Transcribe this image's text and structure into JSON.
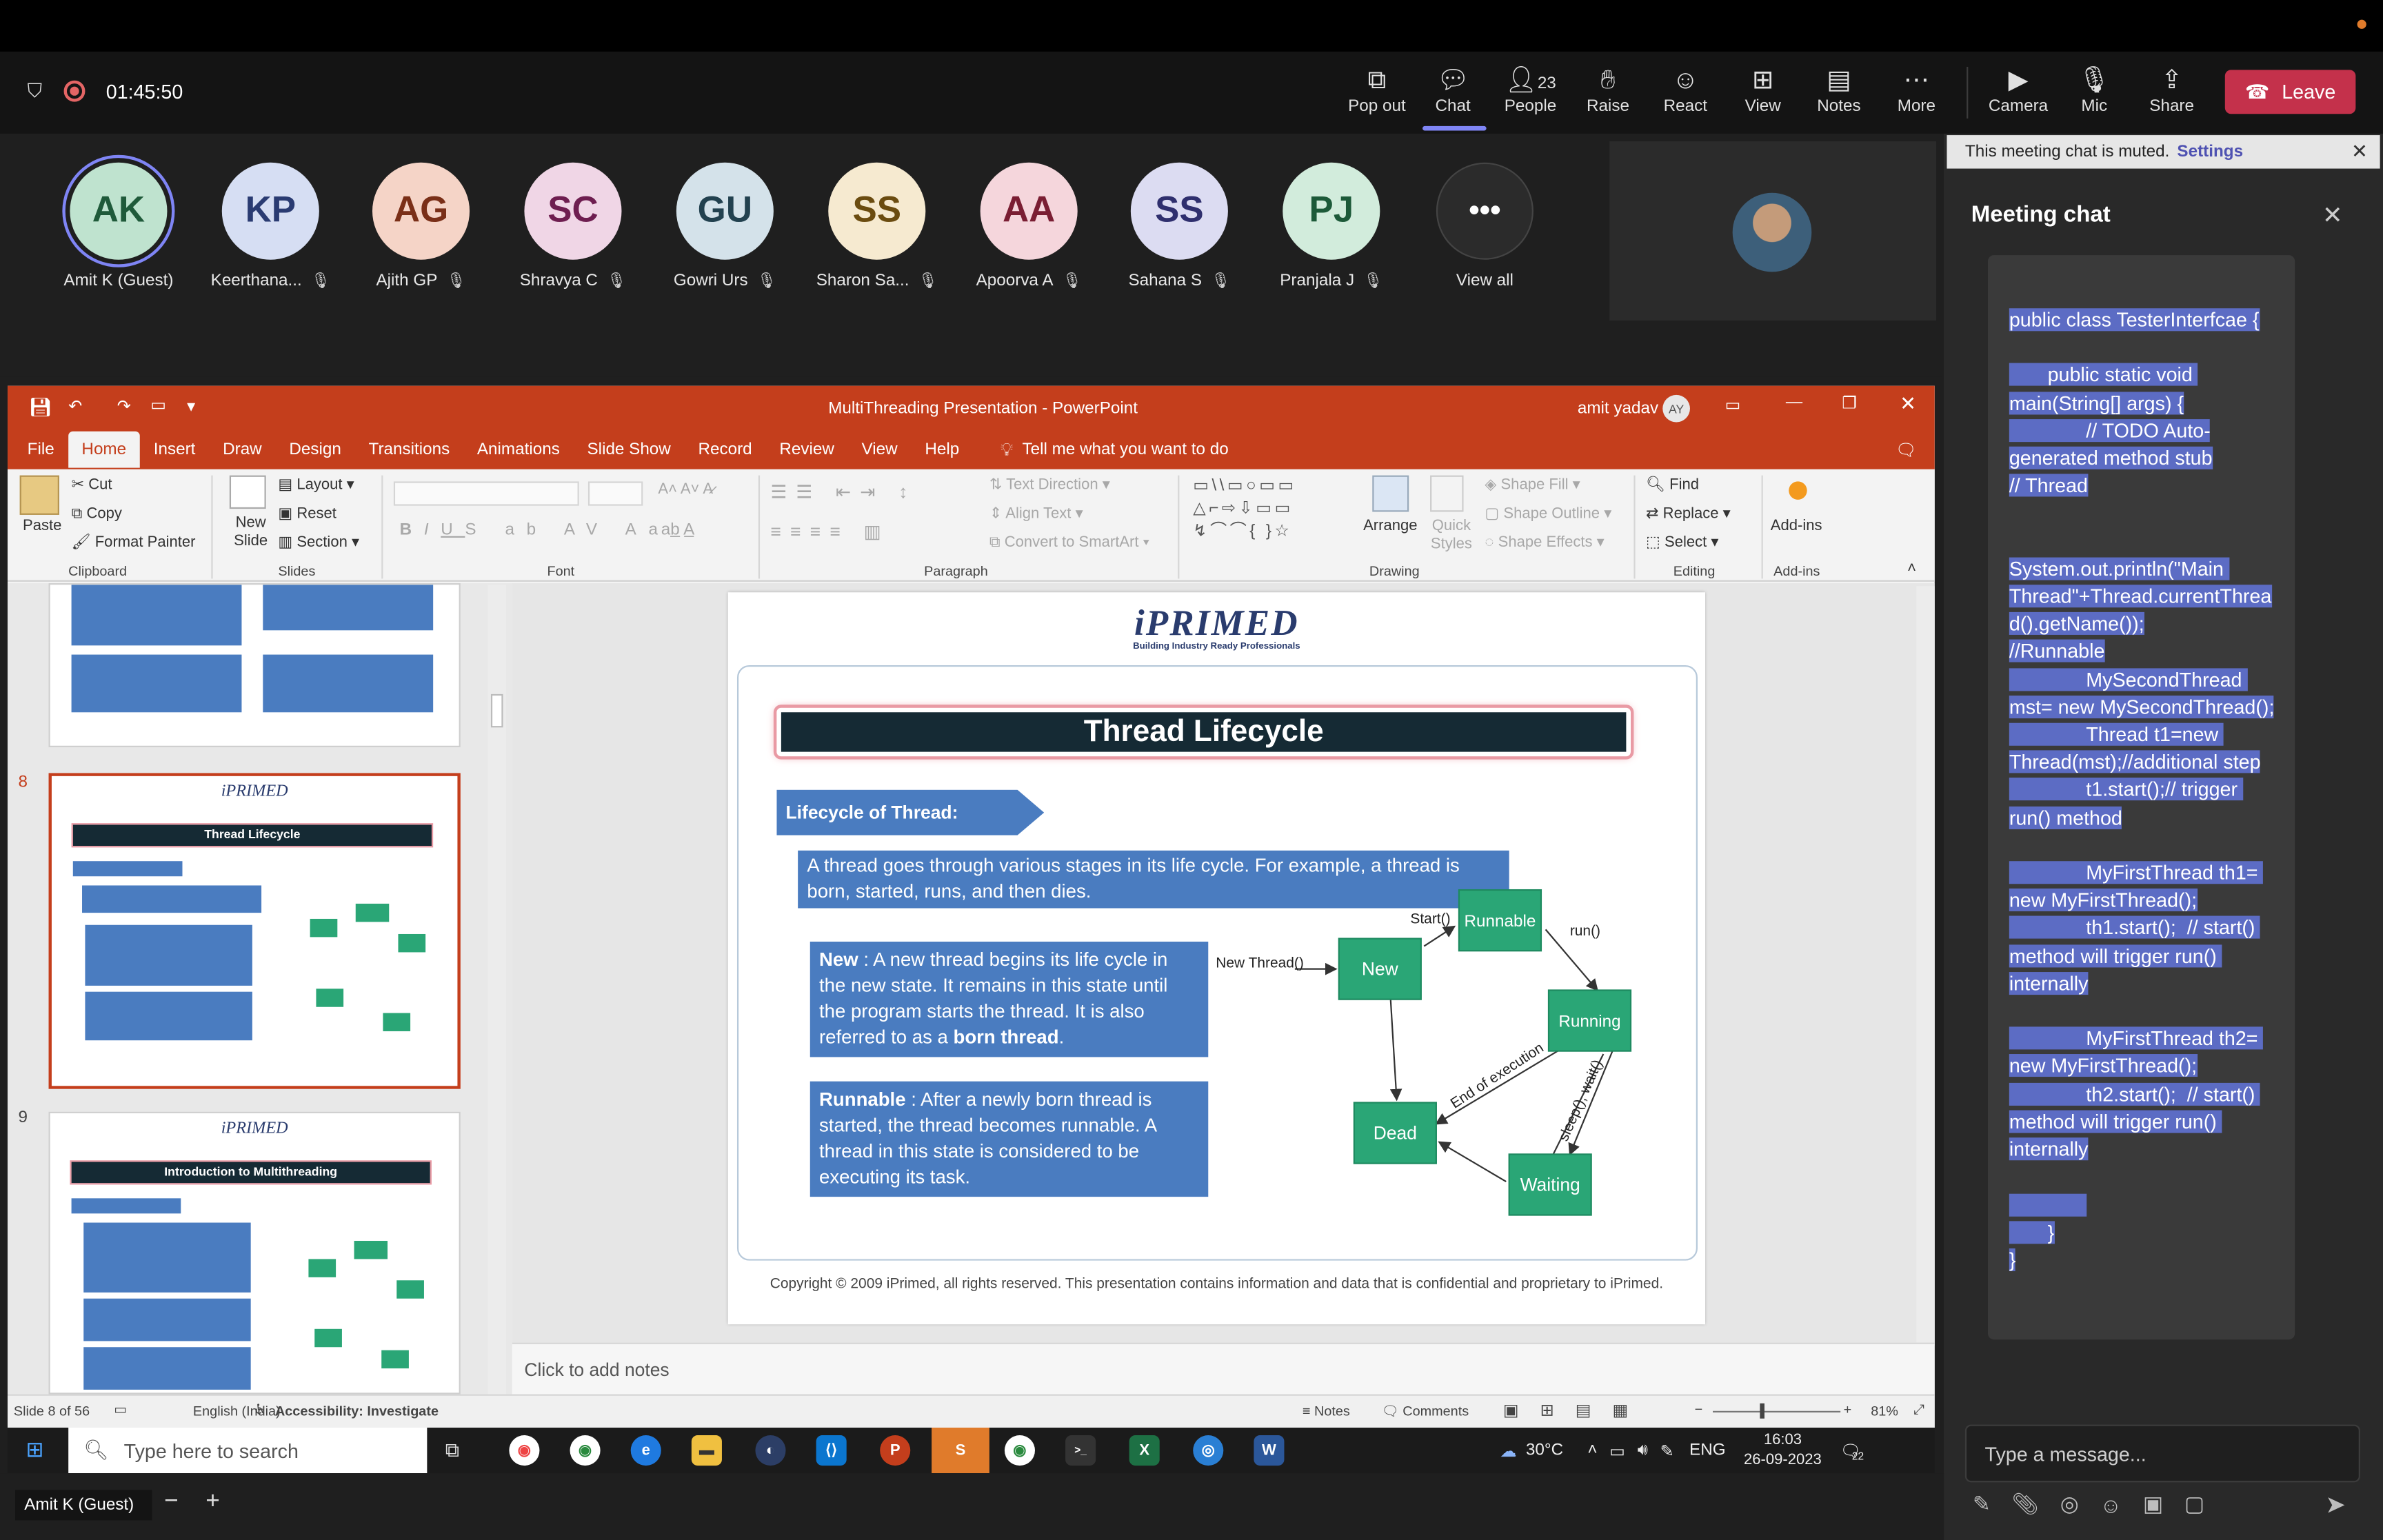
{
  "meeting": {
    "timer": "01:45:50",
    "toolbar": {
      "popout": "Pop out",
      "chat": "Chat",
      "people": "People",
      "people_count": "23",
      "raise": "Raise",
      "react": "React",
      "view": "View",
      "notes": "Notes",
      "more": "More",
      "camera": "Camera",
      "mic": "Mic",
      "share": "Share",
      "leave": "Leave"
    },
    "participants": [
      {
        "initials": "AK",
        "name": "Amit K (Guest)",
        "bg": "#bfe3cf",
        "fg": "#1f5a3a"
      },
      {
        "initials": "KP",
        "name": "Keerthana...",
        "bg": "#d6def3",
        "fg": "#2a3b72"
      },
      {
        "initials": "AG",
        "name": "Ajith GP",
        "bg": "#f5d4c7",
        "fg": "#7a2f18"
      },
      {
        "initials": "SC",
        "name": "Shravya C",
        "bg": "#f0d6e6",
        "fg": "#6e1e50"
      },
      {
        "initials": "GU",
        "name": "Gowri Urs",
        "bg": "#d4e2ea",
        "fg": "#22414f"
      },
      {
        "initials": "SS",
        "name": "Sharon Sa...",
        "bg": "#f6ead0",
        "fg": "#6b4c10"
      },
      {
        "initials": "AA",
        "name": "Apoorva A",
        "bg": "#f5d6dc",
        "fg": "#7a1e33"
      },
      {
        "initials": "SS",
        "name": "Sahana S",
        "bg": "#dcdcf2",
        "fg": "#2f2f6e"
      },
      {
        "initials": "PJ",
        "name": "Pranjala J",
        "bg": "#d2ecdc",
        "fg": "#1d5a39"
      }
    ],
    "view_all": "View all",
    "self_label": "Amit K (Guest)"
  },
  "chat": {
    "muted_notice": "This meeting chat is muted.",
    "settings_link": "Settings",
    "title": "Meeting chat",
    "message": "public class TesterInterfcae {\n\n       public static void main(String[] args) {\n              // TODO Auto-generated method stub\n// Thread\n\n\nSystem.out.println(\"Main Thread\"+Thread.currentThread().getName());\n//Runnable\n              MySecondThread mst= new MySecondThread();\n              Thread t1=new Thread(mst);//additional step\n              t1.start();// trigger run() method\n\n              MyFirstThread th1= new MyFirstThread();\n              th1.start();  // start() method will trigger run() internally\n\n              MyFirstThread th2= new MyFirstThread();\n              th2.start();  // start() method will trigger run() internally\n\n              \n       }\n}",
    "composer_placeholder": "Type a message..."
  },
  "ppt": {
    "title": "MultiThreading Presentation  -  PowerPoint",
    "user": "amit yadav",
    "user_initials": "AY",
    "tabs": [
      "File",
      "Home",
      "Insert",
      "Draw",
      "Design",
      "Transitions",
      "Animations",
      "Slide Show",
      "Record",
      "Review",
      "View",
      "Help"
    ],
    "tell_me": "Tell me what you want to do",
    "ribbon": {
      "paste": "Paste",
      "cut": "Cut",
      "copy": "Copy",
      "format_painter": "Format Painter",
      "clipboard": "Clipboard",
      "new_slide": "New Slide",
      "layout": "Layout",
      "reset": "Reset",
      "section": "Section",
      "slides": "Slides",
      "font": "Font",
      "text_direction": "Text Direction",
      "align_text": "Align Text",
      "convert_smartart": "Convert to SmartArt",
      "paragraph": "Paragraph",
      "arrange": "Arrange",
      "quick_styles": "Quick Styles",
      "shape_fill": "Shape Fill",
      "shape_outline": "Shape Outline",
      "shape_effects": "Shape Effects",
      "drawing": "Drawing",
      "find": "Find",
      "replace": "Replace",
      "select": "Select",
      "editing": "Editing",
      "addins": "Add-ins",
      "addins_group": "Add-ins"
    },
    "thumbnails": [
      {
        "num": "8",
        "title": "Thread Lifecycle"
      },
      {
        "num": "9",
        "title": "Introduction to Multithreading"
      }
    ],
    "slide": {
      "logo": "iPRIMED",
      "logo_tag": "Building Industry Ready Professionals",
      "title": "Thread Lifecycle",
      "subheading": "Lifecycle of Thread:",
      "intro": "A thread goes through various stages in its life cycle. For example, a thread is born, started, runs, and then dies.",
      "new_term": "New",
      "new_text": " : A new thread begins its life cycle in the new state. It remains in this state until the program starts the thread. It is also referred to as a ",
      "new_bold": "born thread",
      "runnable_term": "Runnable",
      "runnable_text": " : After a newly born thread is started, the thread becomes runnable. A thread in this state is considered to be executing its task.",
      "diagram": {
        "new_thread": "New Thread()",
        "new": "New",
        "runnable": "Runnable",
        "running": "Running",
        "dead": "Dead",
        "waiting": "Waiting",
        "start": "Start()",
        "run": "run()",
        "end_exec": "End of execution",
        "sleep_wait": "sleep(), wait()"
      },
      "copyright": "Copyright © 2009 iPrimed, all rights reserved. This presentation contains information  and data  that is confidential and proprietary to iPrimed."
    },
    "notes_placeholder": "Click to add notes",
    "status": {
      "slide_of": "Slide 8 of 56",
      "language": "English (India)",
      "accessibility": "Accessibility: Investigate",
      "notes": "Notes",
      "comments": "Comments",
      "zoom": "81%"
    }
  },
  "taskbar": {
    "search": "Type here to search",
    "weather": "30°C",
    "lang": "ENG",
    "time": "16:03",
    "date": "26-09-2023",
    "notif": "22"
  },
  "colors": {
    "leave": "#c4314b",
    "ppt_brand": "#c43e1c",
    "slide_box": "#4a7cc0",
    "node": "#2aa676"
  }
}
